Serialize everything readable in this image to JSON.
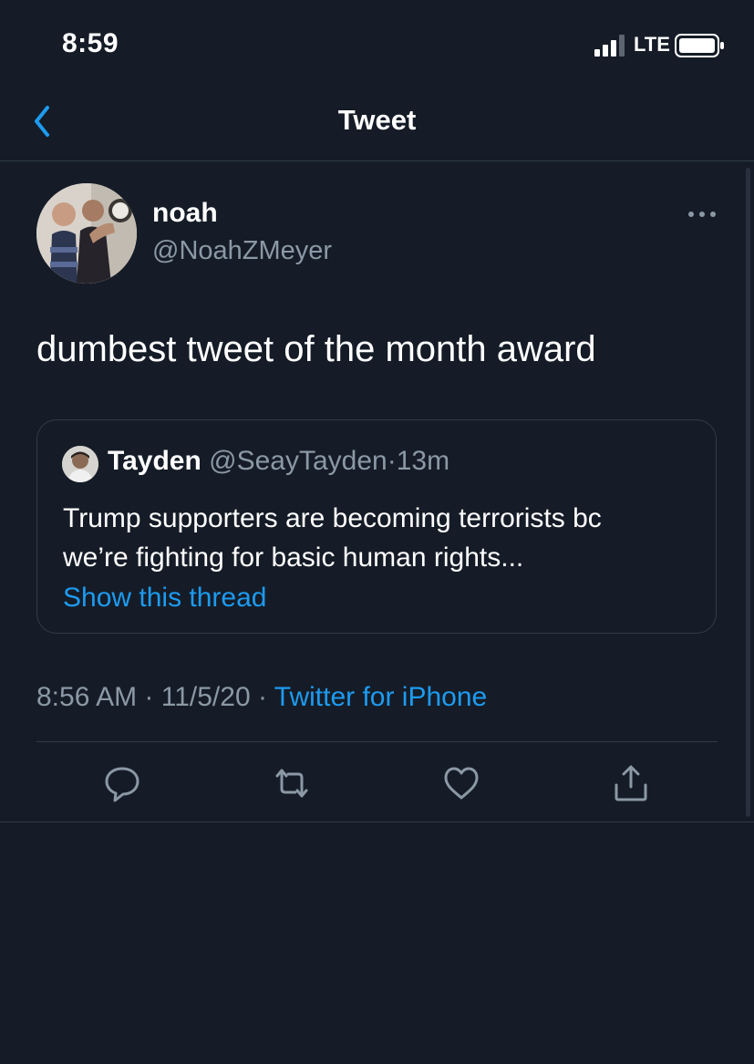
{
  "status_bar": {
    "time": "8:59",
    "network": "LTE",
    "signal_icon": "signal-bars-icon",
    "battery_icon": "battery-icon"
  },
  "header": {
    "title": "Tweet",
    "back_icon": "chevron-left-icon"
  },
  "tweet": {
    "author": {
      "name": "noah",
      "handle": "@NoahZMeyer"
    },
    "more_icon": "more-horizontal-icon",
    "text": "dumbest tweet of the month award",
    "quoted": {
      "name": "Tayden",
      "handle": "@SeayTayden",
      "separator": "·",
      "time": "13m",
      "text_lines": [
        "Trump supporters are becoming terrorists bc",
        "we’re fighting for basic human rights..."
      ],
      "show_thread": "Show this thread"
    },
    "meta": {
      "time": "8:56 AM",
      "sep1": "·",
      "date": "11/5/20",
      "sep2": "·",
      "source": "Twitter for iPhone"
    },
    "actions": {
      "reply_icon": "reply-icon",
      "retweet_icon": "retweet-icon",
      "like_icon": "heart-icon",
      "share_icon": "share-icon"
    }
  },
  "colors": {
    "background": "#151c27",
    "text_primary": "#ffffff",
    "text_secondary": "#8b98a5",
    "accent": "#1d9bf0",
    "border": "#313b49"
  }
}
